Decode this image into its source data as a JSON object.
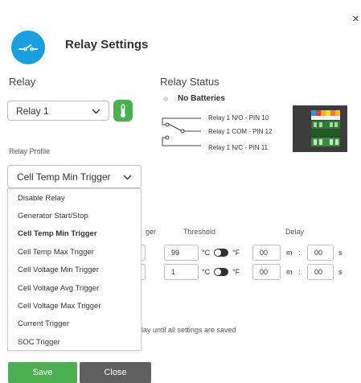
{
  "header": {
    "close_glyph": "×",
    "icon": "relay-switch-icon",
    "title": "Relay Settings"
  },
  "relay": {
    "label": "Relay",
    "selected": "Relay 1",
    "thermo_icon": "thermometer-icon"
  },
  "status": {
    "label": "Relay Status",
    "battery_text": "No Batteries",
    "pins": [
      "Relay 1 N/O - PIN 10",
      "Relay 1 COM - PIN 12",
      "Relay 1 N/C - PIN 11"
    ]
  },
  "profile": {
    "label": "Relay Profile",
    "selected": "Cell Temp Min Trigger",
    "options": [
      "Disable Relay",
      "Generator Start/Stop",
      "Cell Temp Min Trigger",
      "Cell Temp Max Trigger",
      "Cell Voltage Min Trigger",
      "Cell Voltage Avg Trigger",
      "Cell Voltage Max Trigger",
      "Current Trigger",
      "SOC Trigger"
    ],
    "selected_index": 2
  },
  "thresholds": {
    "col_trigger_fragment": "ger",
    "col_threshold": "Threshold",
    "col_delay": "Delay",
    "rows": [
      {
        "value": "99",
        "unit_c": "°C",
        "unit_f": "°F",
        "minutes": "00",
        "m_label": "m",
        "colon": ":",
        "seconds": "00",
        "s_label": "s"
      },
      {
        "value": "1",
        "unit_c": "°C",
        "unit_f": "°F",
        "minutes": "00",
        "m_label": "m",
        "colon": ":",
        "seconds": "00",
        "s_label": "s"
      }
    ]
  },
  "note": {
    "fragment": "lay until all settings are saved"
  },
  "footer": {
    "save_label": "Save",
    "close_label": "Close"
  },
  "colors": {
    "accent_blue": "#1aa0e0",
    "save_green": "#4caf50",
    "close_gray": "#5f5f5f"
  }
}
